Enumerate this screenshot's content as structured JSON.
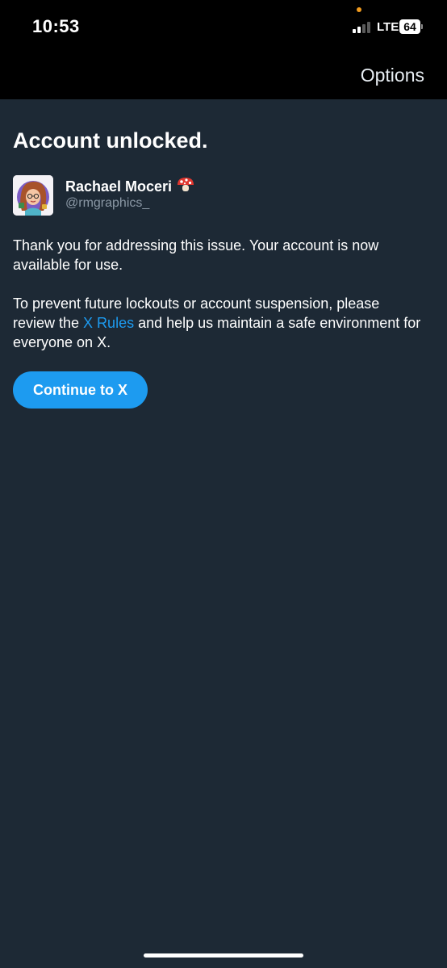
{
  "status_bar": {
    "time": "10:53",
    "network": "LTE",
    "battery": "64",
    "icons": [
      "privacy-indicator-dot",
      "cellular-signal-icon",
      "battery-icon"
    ]
  },
  "nav": {
    "options_label": "Options"
  },
  "page": {
    "title": "Account unlocked."
  },
  "user": {
    "display_name": "Rachael Moceri",
    "name_emoji_icon": "mushroom-icon",
    "handle": "@rmgraphics_",
    "avatar_icon": "avatar-illustration"
  },
  "message": {
    "paragraph1": "Thank you for addressing this issue. Your account is now available for use.",
    "paragraph2_before": "To prevent future lockouts or account suspension, please review the ",
    "paragraph2_link": "X Rules",
    "paragraph2_after": " and help us maintain a safe environment for everyone on X."
  },
  "actions": {
    "continue_label": "Continue to X"
  },
  "colors": {
    "background": "#1d2935",
    "topbar": "#000000",
    "accent": "#1d9bf0",
    "secondary_text": "#8b98a5",
    "privacy_dot": "#f19b1e"
  }
}
